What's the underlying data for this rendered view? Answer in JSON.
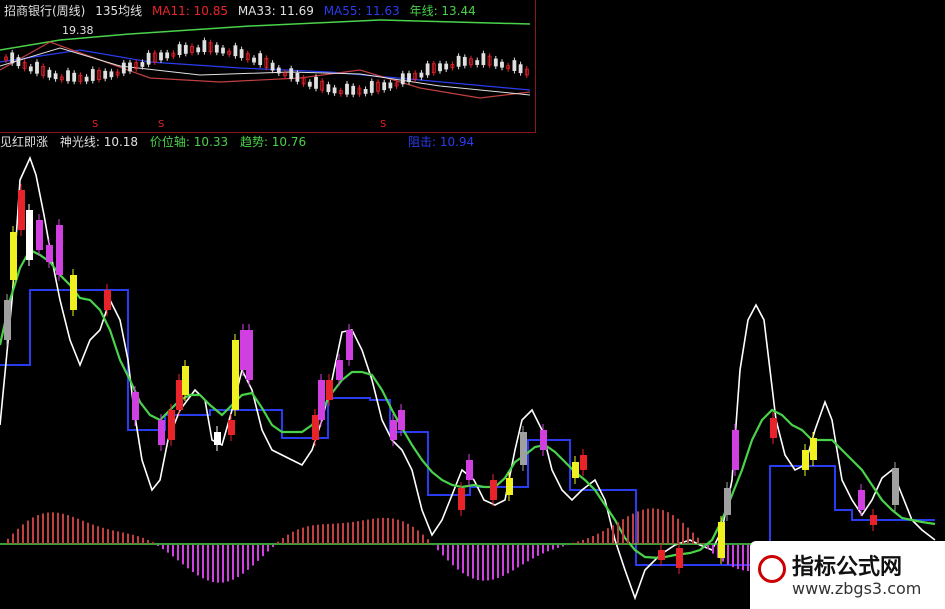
{
  "header": {
    "stock_title": "招商银行(周线)",
    "ma135_label": "135均线",
    "ma11": "MA11: 10.85",
    "ma33": "MA33: 11.69",
    "ma55": "MA55: 11.63",
    "year_line": "年线: 13.44",
    "price_marker": "19.38",
    "marker_s1": "S",
    "marker_s2": "S",
    "marker_s3": "S"
  },
  "indicator": {
    "name": "见红即涨",
    "shenguang": "神光线: 10.18",
    "jiawei": "价位轴: 10.33",
    "qushi": "趋势: 10.76",
    "zuli": "阻击: 10.94"
  },
  "watermark": {
    "title": "指标公式网",
    "url": "www.zbgs3.com"
  },
  "colors": {
    "red": "#e8242a",
    "magenta": "#d040e0",
    "yellow": "#f0f020",
    "grey": "#a0a0a0",
    "white": "#ffffff",
    "green": "#4ad24a",
    "blue": "#2a3cf0",
    "brown": "#c04040",
    "header_white": "#e0e0e0"
  }
}
